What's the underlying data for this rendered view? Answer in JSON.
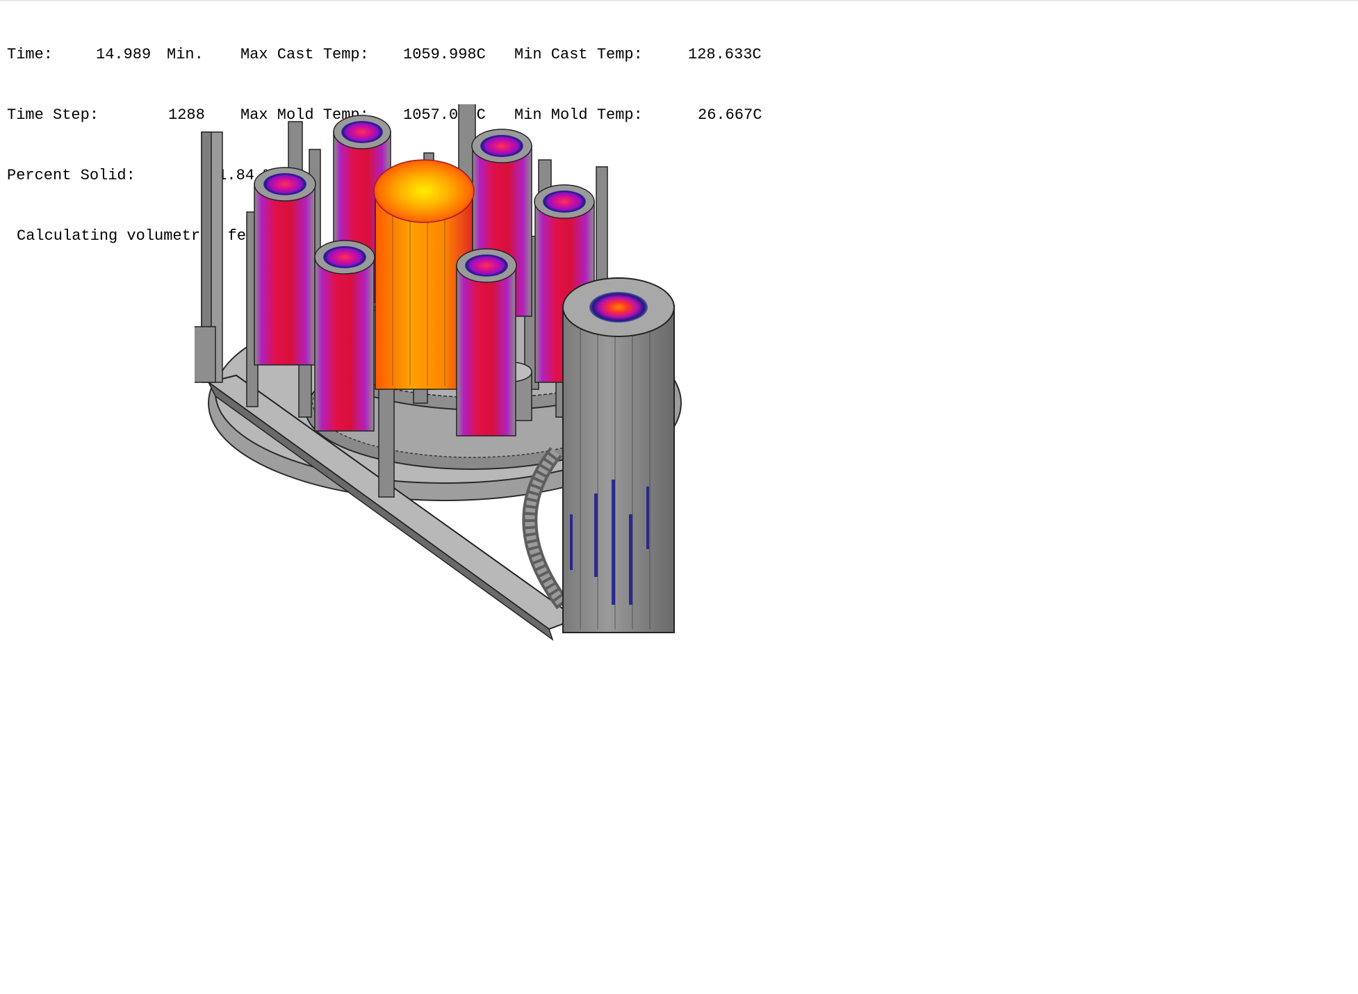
{
  "readout": {
    "time_label": "Time:",
    "time_value": "14.989",
    "time_unit": "Min.",
    "max_cast_label": "Max Cast Temp:",
    "max_cast_value": "1059.998C",
    "min_cast_label": "Min Cast Temp:",
    "min_cast_value": "128.633C",
    "step_label": "Time Step:",
    "step_value": "1288",
    "max_mold_label": "Max Mold Temp:",
    "max_mold_value": "1057.098C",
    "min_mold_label": "Min Mold Temp:",
    "min_mold_value": "26.667C",
    "solid_label": "Percent Solid:",
    "solid_value": "61.84 %",
    "status": "Calculating volumetric feeding"
  },
  "colors": {
    "background": "#ffffff",
    "metal_light": "#b8b8b8",
    "metal_mid": "#8e8e8e",
    "metal_dark": "#5e5e5e",
    "hot_core": "#ffee00",
    "hot_mid": "#ff8c00",
    "warm": "#e8104a",
    "cool": "#c020c0",
    "cold": "#1a1a8c"
  }
}
